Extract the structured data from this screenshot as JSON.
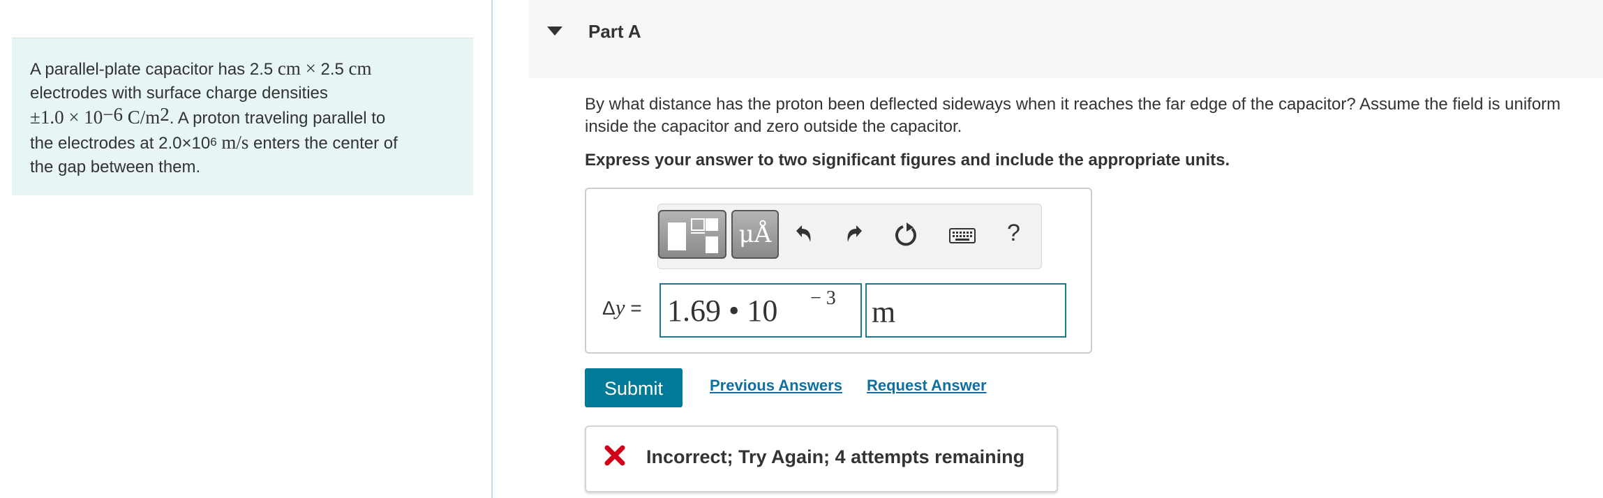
{
  "problem": {
    "line1": "A parallel-plate capacitor has 2.5",
    "unit_cm": "cm",
    "times": "×",
    "dim2": "2.5",
    "line2": "electrodes with surface charge densities",
    "pm_value": "±1.0 × 10",
    "exp_neg6": "−6",
    "density_unit": "C/m",
    "exp_2": "2",
    "line3_rest": ". A proton traveling parallel to",
    "line4_start": "the electrodes at 2.0×10",
    "exp_6": "6",
    "speed_unit": "m/s",
    "line4_rest": "enters the center of",
    "line5": "the gap between them."
  },
  "part": {
    "title": "Part A"
  },
  "question": "By what distance has the proton been deflected sideways when it reaches the far edge of the capacitor? Assume the field is uniform inside the capacitor and zero outside the capacitor.",
  "instruction": "Express your answer to two significant figures and include the appropriate units.",
  "toolbar": {
    "units_label": "μÅ",
    "help_label": "?",
    "icons": [
      "templates-icon",
      "units-icon",
      "undo-icon",
      "redo-icon",
      "reset-icon",
      "keyboard-icon",
      "help-icon"
    ]
  },
  "answer": {
    "var_delta": "Δ",
    "var_y": "y",
    "equals": " =",
    "value": "1.69 • 10",
    "exponent": "− 3",
    "unit": "m"
  },
  "buttons": {
    "submit": "Submit",
    "previous_answers": "Previous Answers",
    "request_answer": "Request Answer"
  },
  "feedback": {
    "text": "Incorrect; Try Again; 4 attempts remaining",
    "icon": "x-mark-icon",
    "color": "#d0021b"
  },
  "colors": {
    "accent": "#007a96",
    "link": "#0f6fa0",
    "panel_bg": "#e8f5f5"
  }
}
